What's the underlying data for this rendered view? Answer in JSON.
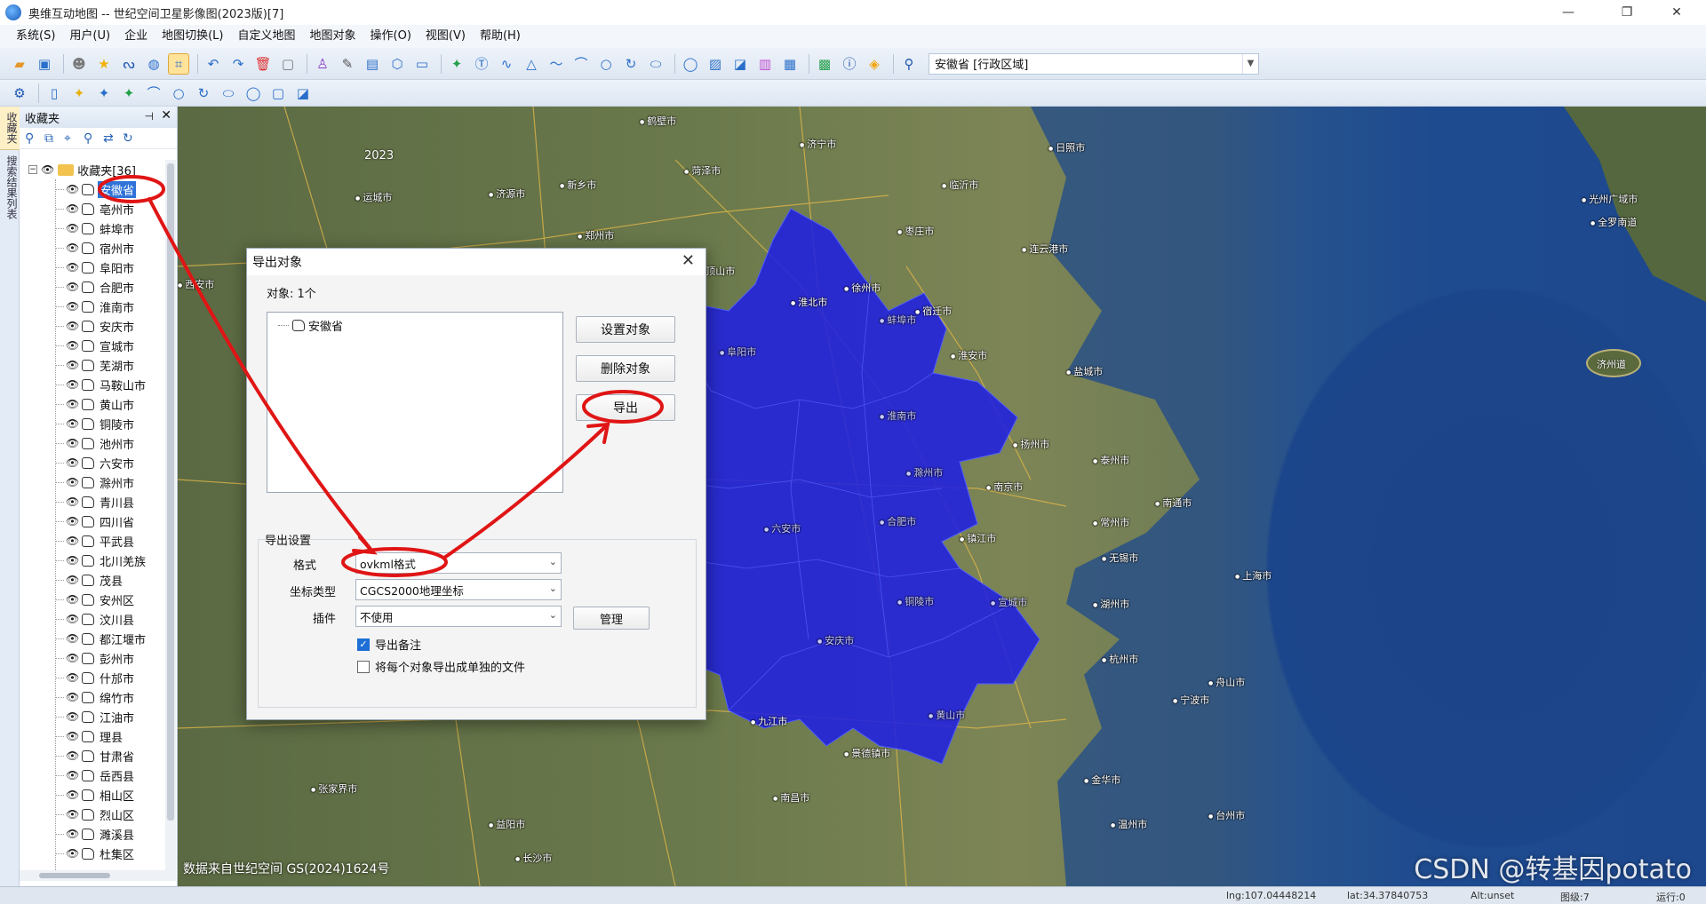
{
  "window": {
    "title": "奥维互动地图 -- 世纪空间卫星影像图(2023版)[7]",
    "minimize": "—",
    "maximize": "❐",
    "close": "✕"
  },
  "menu": [
    "系统(S)",
    "用户(U)",
    "企业",
    "地图切换(L)",
    "自定义地图",
    "地图对象",
    "操作(O)",
    "视图(V)",
    "帮助(H)"
  ],
  "toolbar": {
    "search_value": "安徽省 [行政区域]"
  },
  "side_tabs": [
    "收藏夹",
    "搜索结果列表"
  ],
  "favorites": {
    "title": "收藏夹",
    "root_label": "收藏夹[36]",
    "items": [
      "安徽省",
      "亳州市",
      "蚌埠市",
      "宿州市",
      "阜阳市",
      "合肥市",
      "淮南市",
      "安庆市",
      "宣城市",
      "芜湖市",
      "马鞍山市",
      "黄山市",
      "铜陵市",
      "池州市",
      "六安市",
      "滁州市",
      "青川县",
      "四川省",
      "平武县",
      "北川羌族",
      "茂县",
      "安州区",
      "汶川县",
      "都江堰市",
      "彭州市",
      "什邡市",
      "绵竹市",
      "江油市",
      "理县",
      "甘肃省",
      "岳西县",
      "相山区",
      "烈山区",
      "濉溪县",
      "杜集区"
    ],
    "selected_index": 0
  },
  "map": {
    "year": "2023",
    "credit": "数据来自世纪空间  GS(2024)1624号",
    "watermark": "CSDN @转基因potato",
    "island_label": "济州道",
    "places": [
      "鹤壁市",
      "济宁市",
      "日照市",
      "运城市",
      "济源市",
      "新乡市",
      "临沂市",
      "菏泽市",
      "郑州市",
      "枣庄市",
      "连云港市",
      "西安市",
      "平顶山市",
      "徐州市",
      "淮北市",
      "宿迁市",
      "淮安市",
      "盐城市",
      "扬州市",
      "泰州市",
      "南通市",
      "南京市",
      "镇江市",
      "常州市",
      "无锡市",
      "上海市",
      "湖州市",
      "杭州市",
      "宁波市",
      "舟山市",
      "九江市",
      "景德镇市",
      "金华市",
      "南昌市",
      "台州市",
      "温州市",
      "长沙市",
      "益阳市",
      "张家界市",
      "光州广域市",
      "全罗南道"
    ],
    "region_labels": [
      "阜阳市",
      "合肥市",
      "六安市",
      "安庆市",
      "铜陵市",
      "宣城市",
      "黄山市",
      "滁州市",
      "淮南市",
      "蚌埠市"
    ]
  },
  "dialog": {
    "title": "导出对象",
    "close": "✕",
    "object_count": "对象: 1个",
    "object_item": "安徽省",
    "btn_set": "设置对象",
    "btn_delete": "删除对象",
    "btn_export": "导出",
    "settings_title": "导出设置",
    "format_label": "格式",
    "format_value": "ovkml格式",
    "coord_label": "坐标类型",
    "coord_value": "CGCS2000地理坐标",
    "plugin_label": "插件",
    "plugin_value": "不使用",
    "btn_manage": "管理",
    "chk_export_note": "导出备注",
    "chk_export_note_checked": true,
    "chk_separate": "将每个对象导出成单独的文件",
    "chk_separate_checked": false
  },
  "status": {
    "lng": "lng:107.04448214",
    "lat": "lat:34.37840753",
    "alt": "Alt:unset",
    "zoom": "图级:7",
    "run": "运行:0"
  },
  "colors": {
    "highlight_region": "#2020e0",
    "annotation": "#e01515",
    "selection": "#2f73d8"
  }
}
